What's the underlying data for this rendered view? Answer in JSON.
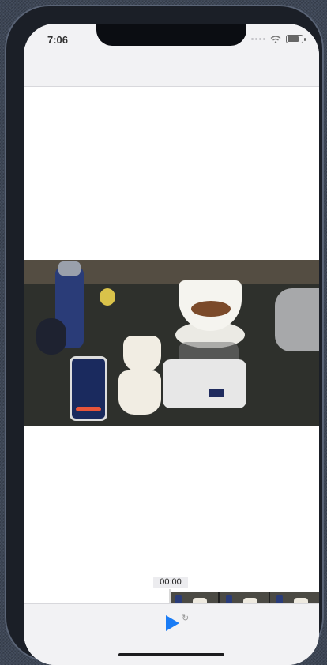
{
  "status_bar": {
    "time": "7:06"
  },
  "player": {
    "current_time": "00:00",
    "video_description_icon": "video-frame",
    "play_icon": "play-icon"
  },
  "colors": {
    "accent": "#1a7cf5"
  }
}
